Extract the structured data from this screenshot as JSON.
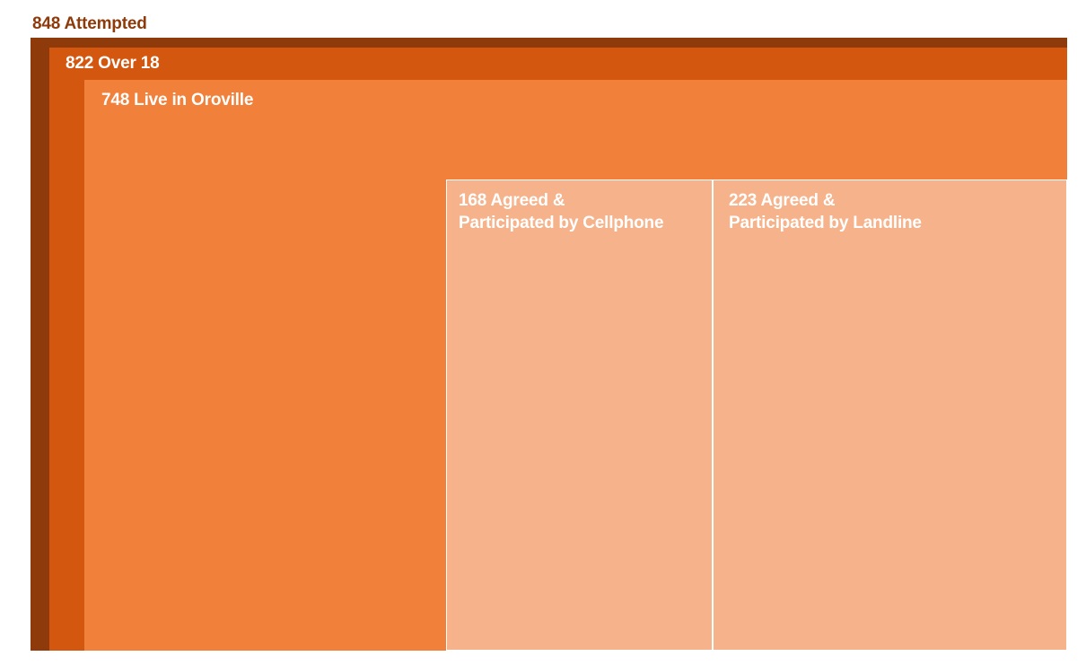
{
  "chart_data": {
    "type": "nested-area",
    "levels": [
      {
        "value": 848,
        "label": "848 Attempted",
        "color": "#8E3A0A"
      },
      {
        "value": 822,
        "label": "822 Over 18",
        "color": "#D4570F"
      },
      {
        "value": 748,
        "label": "748 Live in Oroville",
        "color": "#F0803A"
      }
    ],
    "segments": [
      {
        "value": 168,
        "label_lines": [
          "168 Agreed &",
          "Participated by Cellphone"
        ],
        "color": "#F6B38B"
      },
      {
        "value": 223,
        "label_lines": [
          "223 Agreed &",
          "Participated by Landline"
        ],
        "color": "#F6B38B"
      }
    ],
    "label_colors": {
      "outer": "#8E3A0A",
      "inner": "#FFFFFF"
    }
  }
}
